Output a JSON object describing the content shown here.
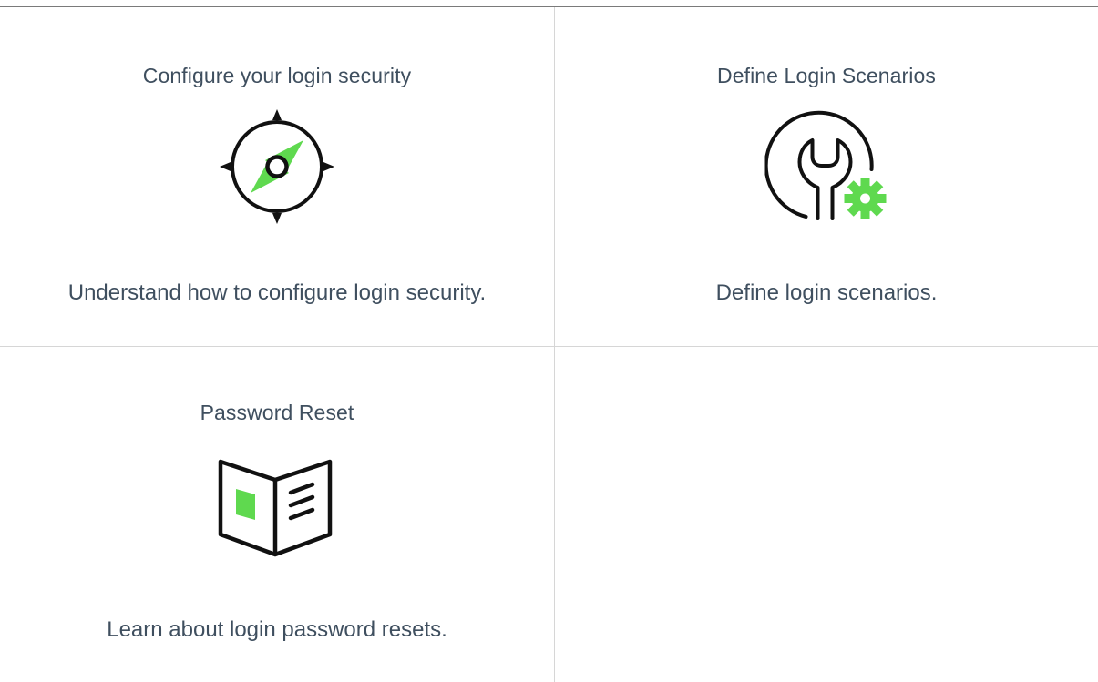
{
  "cards": [
    {
      "title": "Configure your login security",
      "description": "Understand how to configure login security.",
      "icon": "compass-icon"
    },
    {
      "title": "Define Login Scenarios",
      "description": "Define login scenarios.",
      "icon": "wrench-gear-icon"
    },
    {
      "title": "Password Reset",
      "description": "Learn about login password resets.",
      "icon": "open-book-icon"
    }
  ],
  "colors": {
    "text": "#3f4f5f",
    "icon_stroke": "#111111",
    "accent_green": "#5fd94f",
    "divider": "#d6d6d6",
    "top_rule": "#7a7a7a"
  }
}
